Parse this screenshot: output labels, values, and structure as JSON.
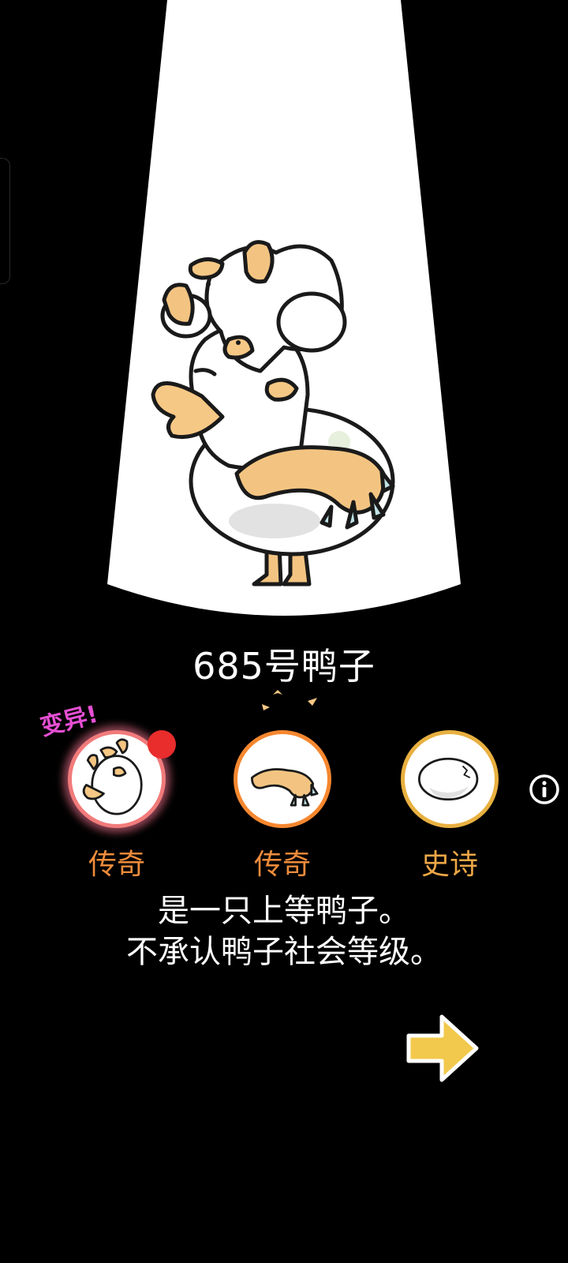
{
  "duck": {
    "name": "685号鸭子"
  },
  "traits": [
    {
      "rarity": "传奇",
      "tag": "变异!",
      "icon": "multi-duck-head-icon",
      "new_badge": true,
      "color": "#f17b7b"
    },
    {
      "rarity": "传奇",
      "icon": "claw-arm-icon",
      "color": "#f6872f"
    },
    {
      "rarity": "史诗",
      "icon": "cracked-egg-body-icon",
      "color": "#e8b040"
    }
  ],
  "description": {
    "line1": "是一只上等鸭子。",
    "line2": "不承认鸭子社会等级。"
  },
  "controls": {
    "info_icon": "info-icon",
    "next_icon": "arrow-right-icon"
  },
  "colors": {
    "background": "#000000",
    "legendary": "#ef8c3c",
    "epic": "#efa747",
    "mutation": "#e64fd3",
    "badge": "#e92c2c",
    "arrow": "#f2c94c"
  }
}
